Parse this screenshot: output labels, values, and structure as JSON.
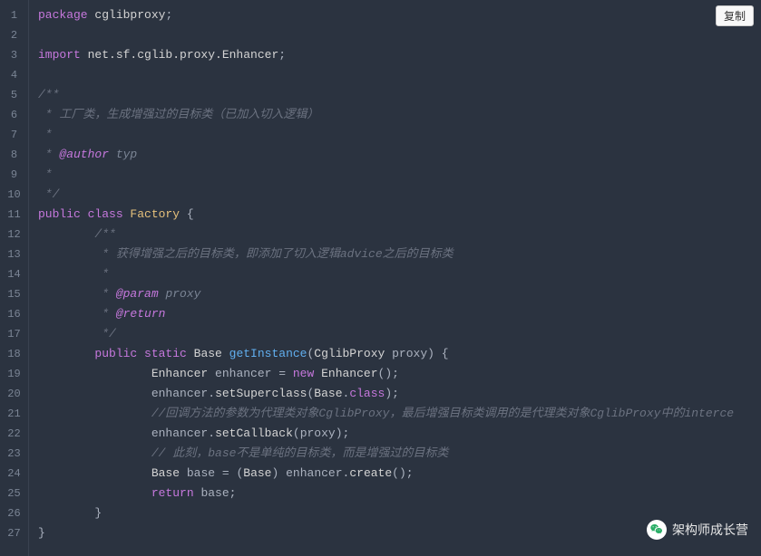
{
  "copy_button": "复制",
  "watermark": "架构师成长营",
  "lines": [
    {
      "n": 1,
      "segs": [
        {
          "c": "kw-pkg",
          "t": "package "
        },
        {
          "c": "pkg-name",
          "t": "cglibproxy"
        },
        {
          "c": "sym",
          "t": ";"
        }
      ]
    },
    {
      "n": 2,
      "segs": []
    },
    {
      "n": 3,
      "segs": [
        {
          "c": "kw-import",
          "t": "import "
        },
        {
          "c": "pkg-name",
          "t": "net.sf.cglib.proxy.Enhancer"
        },
        {
          "c": "sym",
          "t": ";"
        }
      ]
    },
    {
      "n": 4,
      "segs": []
    },
    {
      "n": 5,
      "segs": [
        {
          "c": "comment",
          "t": "/**"
        }
      ]
    },
    {
      "n": 6,
      "segs": [
        {
          "c": "comment",
          "t": " * 工厂类，生成增强过的目标类（已加入切入逻辑）"
        }
      ]
    },
    {
      "n": 7,
      "segs": [
        {
          "c": "comment",
          "t": " * "
        }
      ]
    },
    {
      "n": 8,
      "segs": [
        {
          "c": "comment",
          "t": " * "
        },
        {
          "c": "doc-tag",
          "t": "@author"
        },
        {
          "c": "doc-val",
          "t": " typ"
        }
      ]
    },
    {
      "n": 9,
      "segs": [
        {
          "c": "comment",
          "t": " * "
        }
      ]
    },
    {
      "n": 10,
      "segs": [
        {
          "c": "comment",
          "t": " */"
        }
      ]
    },
    {
      "n": 11,
      "segs": [
        {
          "c": "kw-mod",
          "t": "public "
        },
        {
          "c": "kw-class",
          "t": "class "
        },
        {
          "c": "class-name",
          "t": "Factory"
        },
        {
          "c": "brace",
          "t": " {"
        }
      ]
    },
    {
      "n": 12,
      "indent": "        ",
      "segs": [
        {
          "c": "comment",
          "t": "/**"
        }
      ]
    },
    {
      "n": 13,
      "indent": "        ",
      "segs": [
        {
          "c": "comment",
          "t": " * 获得增强之后的目标类，即添加了切入逻辑advice之后的目标类"
        }
      ]
    },
    {
      "n": 14,
      "indent": "        ",
      "segs": [
        {
          "c": "comment",
          "t": " * "
        }
      ]
    },
    {
      "n": 15,
      "indent": "        ",
      "segs": [
        {
          "c": "comment",
          "t": " * "
        },
        {
          "c": "doc-tag",
          "t": "@param"
        },
        {
          "c": "doc-val",
          "t": " proxy"
        }
      ]
    },
    {
      "n": 16,
      "indent": "        ",
      "segs": [
        {
          "c": "comment",
          "t": " * "
        },
        {
          "c": "doc-tag",
          "t": "@return"
        }
      ]
    },
    {
      "n": 17,
      "indent": "        ",
      "segs": [
        {
          "c": "comment",
          "t": " */"
        }
      ]
    },
    {
      "n": 18,
      "indent": "        ",
      "segs": [
        {
          "c": "kw-mod",
          "t": "public "
        },
        {
          "c": "kw-static",
          "t": "static "
        },
        {
          "c": "type",
          "t": "Base "
        },
        {
          "c": "method",
          "t": "getInstance"
        },
        {
          "c": "sym",
          "t": "("
        },
        {
          "c": "type",
          "t": "CglibProxy "
        },
        {
          "c": "param",
          "t": "proxy"
        },
        {
          "c": "sym",
          "t": ")"
        },
        {
          "c": "brace",
          "t": " {"
        }
      ]
    },
    {
      "n": 19,
      "indent": "                ",
      "segs": [
        {
          "c": "type",
          "t": "Enhancer "
        },
        {
          "c": "var",
          "t": "enhancer"
        },
        {
          "c": "sym",
          "t": " = "
        },
        {
          "c": "kw-new",
          "t": "new "
        },
        {
          "c": "type",
          "t": "Enhancer"
        },
        {
          "c": "sym",
          "t": "();"
        }
      ]
    },
    {
      "n": 20,
      "indent": "                ",
      "segs": [
        {
          "c": "var",
          "t": "enhancer"
        },
        {
          "c": "sym",
          "t": "."
        },
        {
          "c": "call",
          "t": "setSuperclass"
        },
        {
          "c": "sym",
          "t": "("
        },
        {
          "c": "type",
          "t": "Base"
        },
        {
          "c": "sym",
          "t": "."
        },
        {
          "c": "kw-class",
          "t": "class"
        },
        {
          "c": "sym",
          "t": ");"
        }
      ]
    },
    {
      "n": 21,
      "indent": "                ",
      "segs": [
        {
          "c": "comment",
          "t": "//回调方法的参数为代理类对象CglibProxy，最后增强目标类调用的是代理类对象CglibProxy中的interce"
        }
      ]
    },
    {
      "n": 22,
      "indent": "                ",
      "segs": [
        {
          "c": "var",
          "t": "enhancer"
        },
        {
          "c": "sym",
          "t": "."
        },
        {
          "c": "call",
          "t": "setCallback"
        },
        {
          "c": "sym",
          "t": "("
        },
        {
          "c": "var",
          "t": "proxy"
        },
        {
          "c": "sym",
          "t": ");"
        }
      ]
    },
    {
      "n": 23,
      "indent": "                ",
      "segs": [
        {
          "c": "comment",
          "t": "// 此刻，base不是单纯的目标类，而是增强过的目标类"
        }
      ]
    },
    {
      "n": 24,
      "indent": "                ",
      "segs": [
        {
          "c": "type",
          "t": "Base "
        },
        {
          "c": "var",
          "t": "base"
        },
        {
          "c": "sym",
          "t": " = ("
        },
        {
          "c": "type",
          "t": "Base"
        },
        {
          "c": "sym",
          "t": ") "
        },
        {
          "c": "var",
          "t": "enhancer"
        },
        {
          "c": "sym",
          "t": "."
        },
        {
          "c": "call",
          "t": "create"
        },
        {
          "c": "sym",
          "t": "();"
        }
      ]
    },
    {
      "n": 25,
      "indent": "                ",
      "segs": [
        {
          "c": "kw-return",
          "t": "return "
        },
        {
          "c": "var",
          "t": "base"
        },
        {
          "c": "sym",
          "t": ";"
        }
      ]
    },
    {
      "n": 26,
      "indent": "        ",
      "segs": [
        {
          "c": "brace",
          "t": "}"
        }
      ]
    },
    {
      "n": 27,
      "segs": [
        {
          "c": "brace",
          "t": "}"
        }
      ]
    }
  ]
}
